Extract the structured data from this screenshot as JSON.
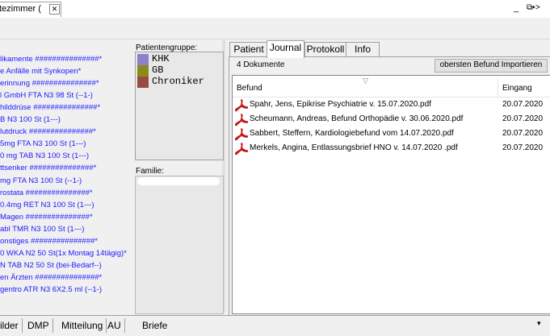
{
  "doc_tab": {
    "label": "tezimmer (",
    "close": "✕"
  },
  "window_controls": {
    "minimize": "_",
    "restore": "⧉",
    "nav": "▸>"
  },
  "medications": [
    "likamente  ###############*",
    "e Anfälle mit Synkopen*",
    "erinnung    ###############*",
    "l GmbH FTA N3 98 St (--1-)",
    "hilddrüse    ###############*",
    "B N3 100 St (1---)",
    "lutdruck    ###############*",
    "5mg FTA N3 100 St (1---)",
    "0 mg TAB N3 100 St (1---)",
    "ttsenker    ###############*",
    "mg FTA N3 100 St (--1-)",
    "rostata    ###############*",
    "0.4mg RET N3 100 St (1---)",
    "Magen    ###############*",
    "abl TMR N3 100 St (1---)",
    "onstiges    ###############*",
    "0 WKA N2 50 St(1x Montag 14tägig)*",
    "N TAB N2 50 St (bei-Bedarf--)",
    "en Ärzten    ###############*",
    "gentro ATR N3 6X2.5 ml (--1-)"
  ],
  "patient_group": {
    "label": "Patientengruppe:",
    "items": [
      {
        "name": "KHK",
        "color": "#8b82c9"
      },
      {
        "name": "GB",
        "color": "#8c8a1a"
      },
      {
        "name": "Chroniker",
        "color": "#9a4a44"
      }
    ]
  },
  "family": {
    "label": "Familie:"
  },
  "tabs": [
    "Patient",
    "Journal",
    "Protokoll",
    "Info"
  ],
  "active_tab": "Journal",
  "journal": {
    "count_label": "4 Dokumente",
    "import_button": "obersten Befund Importieren",
    "columns": {
      "befund": "Befund",
      "eingang": "Eingang"
    },
    "rows": [
      {
        "name": "Spahr, Jens, Epikrise Psychiatrie v. 15.07.2020.pdf",
        "date": "20.07.2020"
      },
      {
        "name": "Scheumann, Andreas, Befund Orthopädie v. 30.06.2020.pdf",
        "date": "20.07.2020"
      },
      {
        "name": "Sabbert, Steffern, Kardiologiebefund vom 14.07.2020.pdf",
        "date": "20.07.2020"
      },
      {
        "name": "Merkels, Angina, Entlassungsbrief HNO  v. 14.07.2020 .pdf",
        "date": "20.07.2020"
      }
    ]
  },
  "bottom_tabs": [
    "ilder",
    "DMP",
    "Mitteilung",
    "AU",
    "Briefe"
  ],
  "bottom_caret": "▾"
}
